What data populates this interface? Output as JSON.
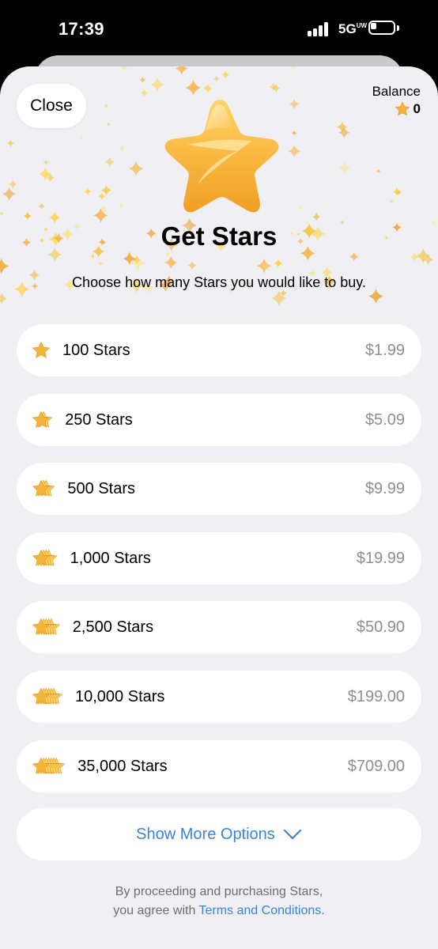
{
  "status_bar": {
    "time": "17:39",
    "network": "5G",
    "network_sub": "UW",
    "battery_level": 0.25
  },
  "header": {
    "close_label": "Close",
    "balance_label": "Balance",
    "balance_value": "0",
    "title": "Get Stars",
    "subtitle": "Choose how many Stars you would like to buy."
  },
  "options": [
    {
      "label": "100 Stars",
      "price": "$1.99",
      "icon_stack": 1
    },
    {
      "label": "250 Stars",
      "price": "$5.09",
      "icon_stack": 2
    },
    {
      "label": "500 Stars",
      "price": "$9.99",
      "icon_stack": 3
    },
    {
      "label": "1,000 Stars",
      "price": "$19.99",
      "icon_stack": 4
    },
    {
      "label": "2,500 Stars",
      "price": "$50.90",
      "icon_stack": 5
    },
    {
      "label": "10,000 Stars",
      "price": "$199.00",
      "icon_stack": 6
    },
    {
      "label": "35,000 Stars",
      "price": "$709.00",
      "icon_stack": 7
    }
  ],
  "more_options": {
    "label": "Show More Options",
    "icon": "chevron-down-icon"
  },
  "footer": {
    "line1": "By proceeding and purchasing Stars,",
    "line2_prefix": "you agree with ",
    "link": "Terms and Conditions",
    "line2_suffix": "."
  },
  "colors": {
    "star_gold": "#f5b53a",
    "star_light": "#ffd46a",
    "link_blue": "#3a84d8",
    "background": "#efeff4",
    "price_gray": "#8e8e93"
  }
}
